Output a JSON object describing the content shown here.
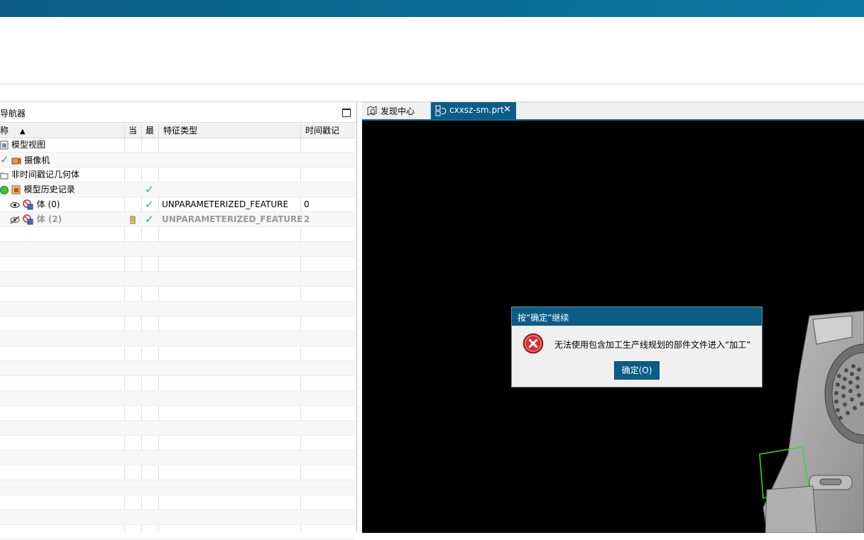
{
  "navigator": {
    "title": "导航器",
    "columns": {
      "name": "称",
      "current": "当",
      "latest": "最",
      "feature_type": "特征类型",
      "timestamp": "时间戳记"
    },
    "rows": [
      {
        "label": "模型视图",
        "feature_type": "",
        "timestamp": ""
      },
      {
        "label": "摄像机",
        "feature_type": "",
        "timestamp": ""
      },
      {
        "label": "非时间戳记几何体",
        "feature_type": "",
        "timestamp": ""
      },
      {
        "label": "模型历史记录",
        "feature_type": "",
        "timestamp": ""
      },
      {
        "label": "体 (0)",
        "feature_type": "UNPARAMETERIZED_FEATURE",
        "timestamp": "0"
      },
      {
        "label": "体 (2)",
        "feature_type": "UNPARAMETERIZED_FEATURE",
        "timestamp": "2"
      }
    ]
  },
  "tabs": [
    {
      "label": "发现中心",
      "active": false
    },
    {
      "label": "cxxsz-sm.prt",
      "active": true
    }
  ],
  "dialog": {
    "title": "按“确定”继续",
    "message": "无法使用包含加工生产线规划的部件文件进入“加工”",
    "ok_label": "确定(O)"
  },
  "colors": {
    "accent": "#0b5d86",
    "check": "#2bb24c",
    "viewport": "#000000"
  }
}
